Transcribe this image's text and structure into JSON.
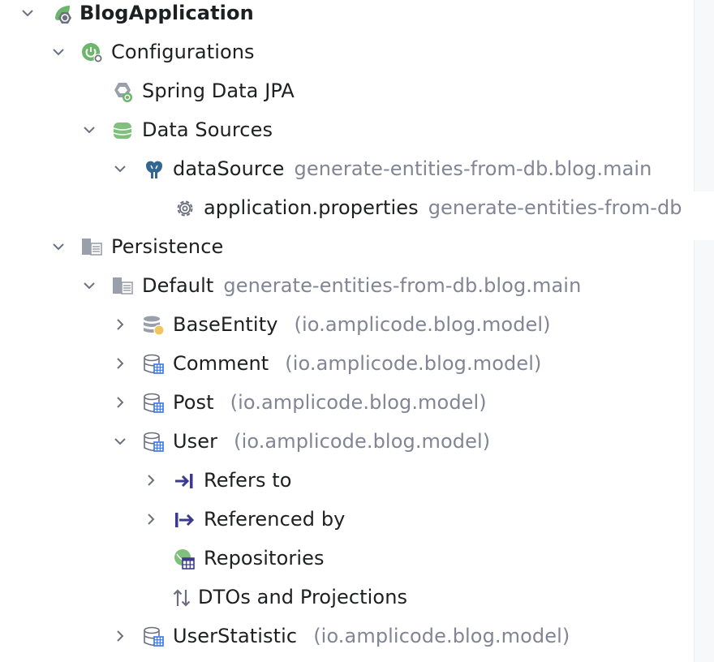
{
  "tree": {
    "root": {
      "label": "BlogApplication"
    },
    "configurations": {
      "label": "Configurations"
    },
    "spring_data_jpa": {
      "label": "Spring Data JPA"
    },
    "data_sources": {
      "label": "Data Sources"
    },
    "data_source": {
      "label": "dataSource",
      "hint": "generate-entities-from-db.blog.main"
    },
    "app_properties": {
      "label": "application.properties",
      "hint": "generate-entities-from-db"
    },
    "persistence": {
      "label": "Persistence"
    },
    "default_unit": {
      "label": "Default",
      "hint": "generate-entities-from-db.blog.main"
    },
    "base_entity": {
      "label": "BaseEntity",
      "hint": "(io.amplicode.blog.model)"
    },
    "comment": {
      "label": "Comment",
      "hint": "(io.amplicode.blog.model)"
    },
    "post": {
      "label": "Post",
      "hint": "(io.amplicode.blog.model)"
    },
    "user": {
      "label": "User",
      "hint": "(io.amplicode.blog.model)"
    },
    "refers_to": {
      "label": "Refers to"
    },
    "referenced_by": {
      "label": "Referenced by"
    },
    "repositories": {
      "label": "Repositories"
    },
    "dtos": {
      "label": "DTOs and Projections"
    },
    "user_statistic": {
      "label": "UserStatistic",
      "hint": "(io.amplicode.blog.model)"
    }
  },
  "colors": {
    "text": "#1e1f22",
    "hint": "#818594",
    "spring_green": "#6cb66b",
    "db_green": "#7fc07a",
    "entity_blue": "#3574f0",
    "relation_indigo": "#3b3a8e",
    "postgres_blue": "#336791"
  }
}
